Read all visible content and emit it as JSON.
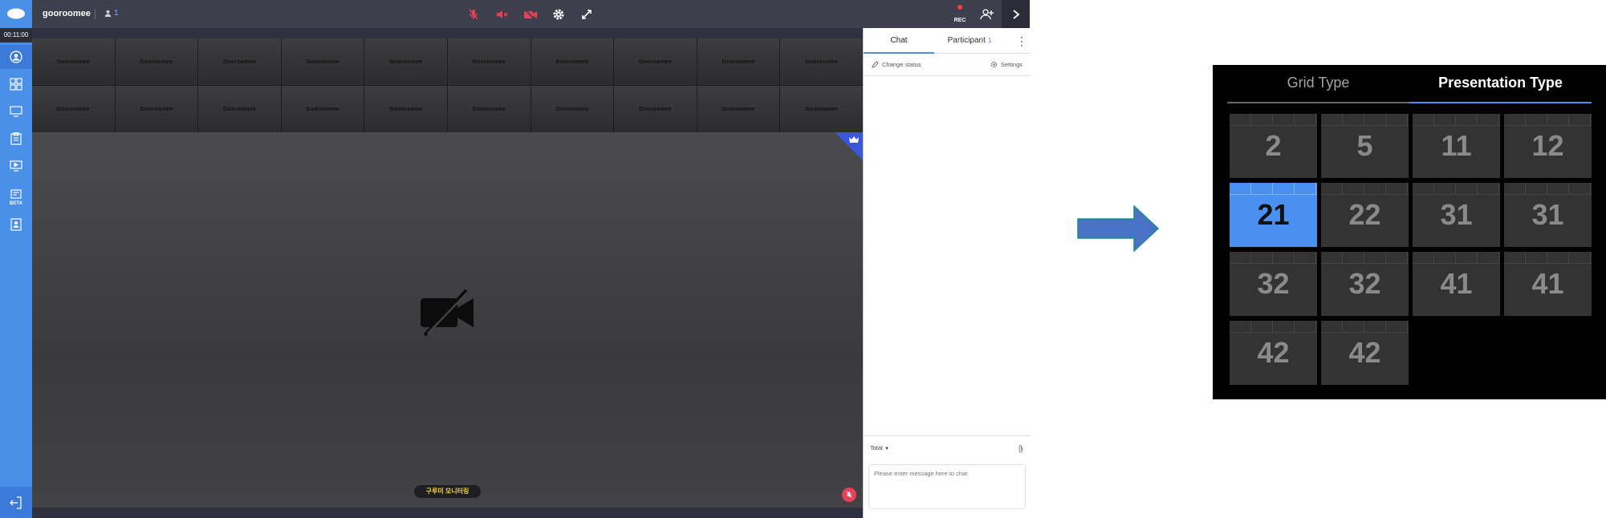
{
  "topbar": {
    "app_name": "gooroomee",
    "participant_count": "1",
    "rec_label": "REC",
    "icons": [
      "mic-muted-icon",
      "speaker-muted-icon",
      "camera-off-icon",
      "settings-gear-icon",
      "fullscreen-icon",
      "invite-user-icon",
      "chevron-right-icon"
    ]
  },
  "sidebar": {
    "timer": "00:11:00",
    "beta_label": "BETA",
    "items": [
      "profile-icon",
      "grid-layout-icon",
      "screen-share-icon",
      "clipboard-icon",
      "presentation-icon",
      "document-beta-icon",
      "contact-card-icon"
    ]
  },
  "video": {
    "thumbnail_label": "Gooroomee",
    "thumbnail_count": 20,
    "speaker_name": "구루미 모니터링"
  },
  "chat": {
    "tab_chat": "Chat",
    "tab_participant": "Participant",
    "participant_count": "1",
    "change_status": "Change status",
    "settings": "Settings",
    "total_label": "Total",
    "input_placeholder": "Please enter message here to chat"
  },
  "layout_picker": {
    "tab_grid": "Grid Type",
    "tab_presentation": "Presentation Type",
    "selected": "21",
    "tiles": [
      "2",
      "5",
      "11",
      "12",
      "21",
      "22",
      "31",
      "31",
      "32",
      "32",
      "41",
      "41",
      "42",
      "42"
    ]
  },
  "colors": {
    "accent": "#4a8fe8",
    "topbar_bg": "#3d3f4c",
    "muted_red": "#e8405a",
    "picker_selected": "#4a90f0"
  }
}
